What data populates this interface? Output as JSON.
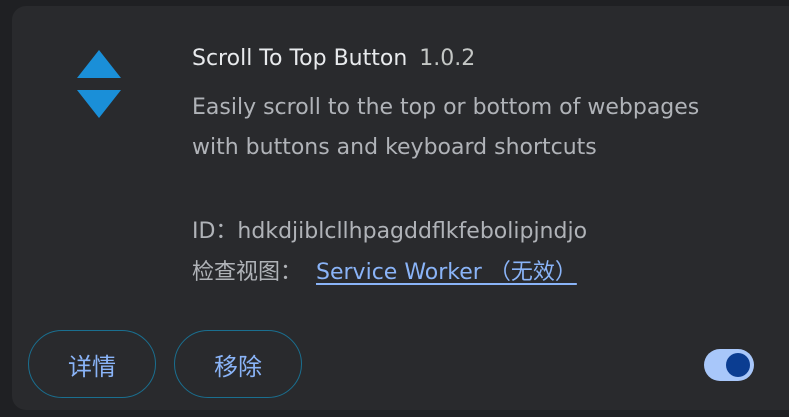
{
  "extension": {
    "name": "Scroll To Top Button",
    "version": "1.0.2",
    "description": "Easily scroll to the top or bottom of webpages with buttons and keyboard shortcuts",
    "id_text": "ID：hdkdjiblcllhpagddflkfebolipjndjo",
    "views_label": "检查视图：",
    "service_worker_link": "Service Worker （无效）",
    "icon": "up-down-arrows-icon",
    "icon_color": "#1a8fd8"
  },
  "actions": {
    "details_label": "详情",
    "remove_label": "移除"
  },
  "toggle": {
    "enabled": true,
    "track_color": "#a8c7fa",
    "knob_color": "#0b3d91"
  }
}
